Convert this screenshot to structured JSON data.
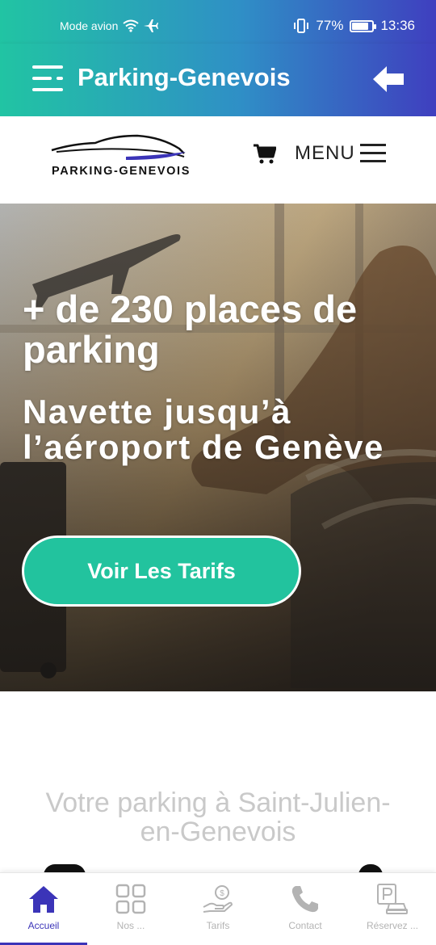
{
  "status_bar": {
    "mode": "Mode avion",
    "battery": "77%",
    "battery_level": 0.77,
    "time": "13:36"
  },
  "app_header": {
    "title": "Parking-Genevois",
    "menu_icon": "hamburger-icon",
    "back_icon": "arrow-left-icon"
  },
  "site_header": {
    "logo_text": "PARKING-GENEVOIS",
    "cart_icon": "cart-icon",
    "menu_label": "MENU"
  },
  "hero": {
    "title": "+ de 230 places de parking",
    "subtitle": "Navette jusqu’à l’aéroport de Genève",
    "cta": "Voir Les Tarifs"
  },
  "section": {
    "heading": "Votre parking à Saint-Julien-en-Genevois"
  },
  "bottom_nav": {
    "active_color": "#3b34b8",
    "items": [
      {
        "label": "Accueil",
        "icon": "home-icon",
        "active": true
      },
      {
        "label": "Nos ...",
        "icon": "grid-icon",
        "active": false
      },
      {
        "label": "Tarifs",
        "icon": "hand-coin-icon",
        "active": false
      },
      {
        "label": "Contact",
        "icon": "phone-icon",
        "active": false
      },
      {
        "label": "Réservez ...",
        "icon": "parking-car-icon",
        "active": false
      }
    ]
  },
  "colors": {
    "header_gradient_start": "#21c4a3",
    "header_gradient_end": "#3f3fbf",
    "cta": "#22c39e"
  }
}
